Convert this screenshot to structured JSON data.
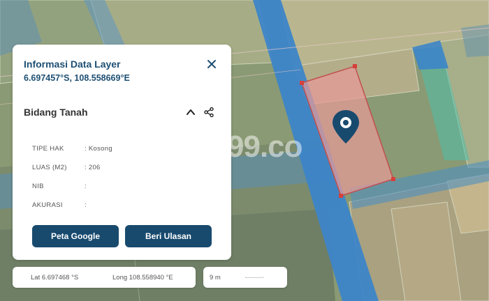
{
  "map": {
    "watermark": "99.co",
    "colors": {
      "road": "#3d85c8",
      "parcel_highlight": "#e79a98",
      "parcel_border": "#c0504d",
      "pin": "#184a6e"
    }
  },
  "info_panel": {
    "title": "Informasi Data Layer",
    "coordinates": "6.697457°S, 108.558669°E",
    "section_title": "Bidang Tanah",
    "rows": [
      {
        "key": "TIPE HAK",
        "value": ": Kosong"
      },
      {
        "key": "LUAS (M2)",
        "value": ": 206"
      },
      {
        "key": "NIB",
        "value": ":"
      },
      {
        "key": "AKURASI",
        "value": ":"
      }
    ],
    "buttons": {
      "google_maps": "Peta Google",
      "review": "Beri Ulasan"
    },
    "icons": [
      "close-icon",
      "chevron-up-icon",
      "share-icon"
    ]
  },
  "coord_bar": {
    "lat": "Lat 6.697468 °S",
    "long": "Long 108.558940 °E"
  },
  "scale": {
    "label": "9 m"
  }
}
